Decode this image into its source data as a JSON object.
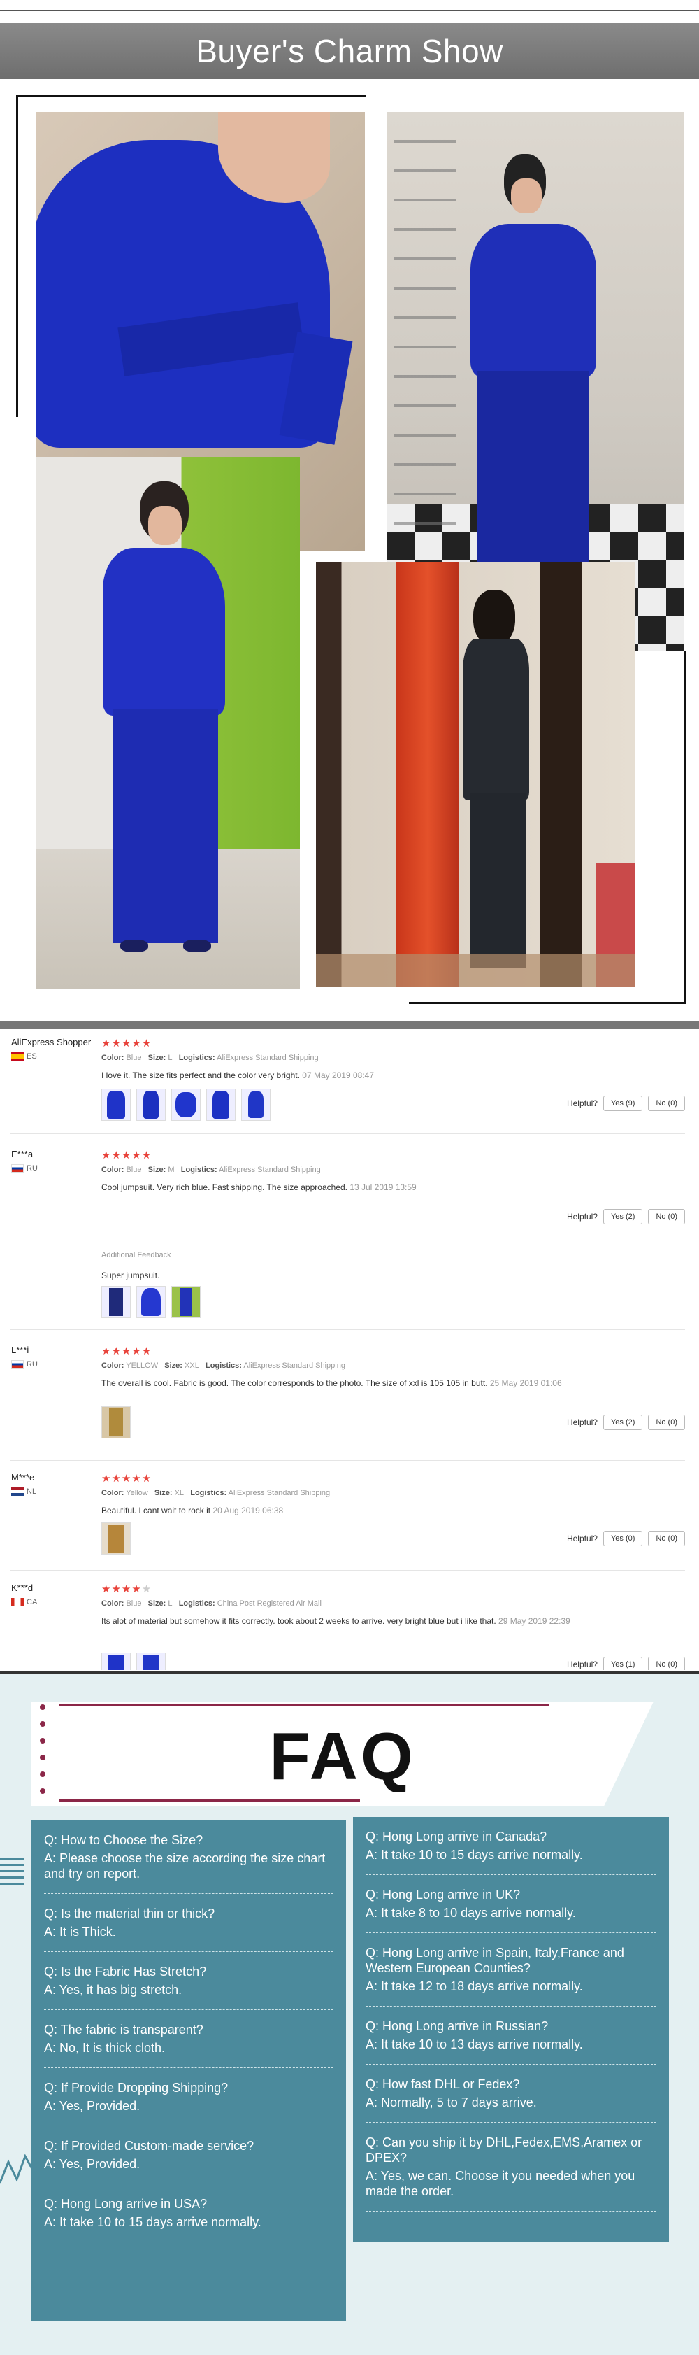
{
  "banner": {
    "title": "Buyer's Charm Show"
  },
  "colors": {
    "accent": "#e8433b",
    "faq_panel": "#4b8a9c",
    "faq_accent": "#8b2748",
    "faq_bg": "#e4f0f2"
  },
  "reviews": [
    {
      "name": "AliExpress Shopper",
      "country": "ES",
      "stars": 5,
      "color_label": "Color:",
      "color": "Blue",
      "size_label": "Size:",
      "size": "L",
      "logistics_label": "Logistics:",
      "logistics": "AliExpress Standard Shipping",
      "text": "I love it. The size fits perfect and the color very bright.",
      "date": "07 May 2019 08:47",
      "helpful_label": "Helpful?",
      "yes": "Yes (9)",
      "no": "No (0)"
    },
    {
      "name": "E***a",
      "country": "RU",
      "stars": 5,
      "color_label": "Color:",
      "color": "Blue",
      "size_label": "Size:",
      "size": "M",
      "logistics_label": "Logistics:",
      "logistics": "AliExpress Standard Shipping",
      "text": "Cool jumpsuit. Very rich blue. Fast shipping. The size approached.",
      "date": "13 Jul 2019 13:59",
      "helpful_label": "Helpful?",
      "yes": "Yes (2)",
      "no": "No (0)",
      "additional_label": "Additional Feedback",
      "additional_text": "Super jumpsuit."
    },
    {
      "name": "L***i",
      "country": "RU",
      "stars": 5,
      "color_label": "Color:",
      "color": "YELLOW",
      "size_label": "Size:",
      "size": "XXL",
      "logistics_label": "Logistics:",
      "logistics": "AliExpress Standard Shipping",
      "text": "The overall is cool. Fabric is good. The color corresponds to the photo. The size of xxl is 105 105 in butt.",
      "date": "25 May 2019 01:06",
      "helpful_label": "Helpful?",
      "yes": "Yes (2)",
      "no": "No (0)"
    },
    {
      "name": "M***e",
      "country": "NL",
      "stars": 5,
      "color_label": "Color:",
      "color": "Yellow",
      "size_label": "Size:",
      "size": "XL",
      "logistics_label": "Logistics:",
      "logistics": "AliExpress Standard Shipping",
      "text": "Beautiful. I cant wait to rock it",
      "date": "20 Aug 2019 06:38",
      "helpful_label": "Helpful?",
      "yes": "Yes (0)",
      "no": "No (0)"
    },
    {
      "name": "K***d",
      "country": "CA",
      "stars": 4,
      "color_label": "Color:",
      "color": "Blue",
      "size_label": "Size:",
      "size": "L",
      "logistics_label": "Logistics:",
      "logistics": "China Post Registered Air Mail",
      "text": "Its alot of material but somehow it fits correctly. took about 2 weeks to arrive. very bright blue but i like that.",
      "date": "29 May 2019 22:39",
      "helpful_label": "Helpful?",
      "yes": "Yes (1)",
      "no": "No (0)"
    }
  ],
  "faq": {
    "title": "FAQ",
    "left": [
      {
        "q": "Q: How to Choose the Size?",
        "a": "A: Please choose the size according the size chart and try on report."
      },
      {
        "q": "Q: Is the material thin or thick?",
        "a": "A: It is Thick."
      },
      {
        "q": "Q: Is the Fabric Has Stretch?",
        "a": "A: Yes, it has big stretch."
      },
      {
        "q": "Q: The fabric is transparent?",
        "a": "A: No, It is thick cloth."
      },
      {
        "q": "Q: If Provide Dropping Shipping?",
        "a": "A: Yes, Provided."
      },
      {
        "q": "Q: If Provided Custom-made service?",
        "a": "A: Yes, Provided."
      },
      {
        "q": "Q: Hong Long arrive in USA?",
        "a": "A: It take 10 to 15 days arrive normally."
      }
    ],
    "right": [
      {
        "q": "Q: Hong Long arrive in Canada?",
        "a": "A: It take 10 to 15 days arrive normally."
      },
      {
        "q": "Q: Hong Long arrive in UK?",
        "a": "A: It take 8 to 10 days arrive normally."
      },
      {
        "q": "Q: Hong Long arrive in Spain, Italy,France and Western European Counties?",
        "a": "A: It take 12 to 18 days arrive normally."
      },
      {
        "q": "Q: Hong Long arrive in Russian?",
        "a": "A: It take 10 to 13 days arrive normally."
      },
      {
        "q": "Q: How fast DHL or Fedex?",
        "a": "A: Normally, 5 to 7 days arrive."
      },
      {
        "q": "Q: Can you ship it by DHL,Fedex,EMS,Aramex or DPEX?",
        "a": "A: Yes, we can. Choose it you needed when you made the order."
      }
    ]
  }
}
